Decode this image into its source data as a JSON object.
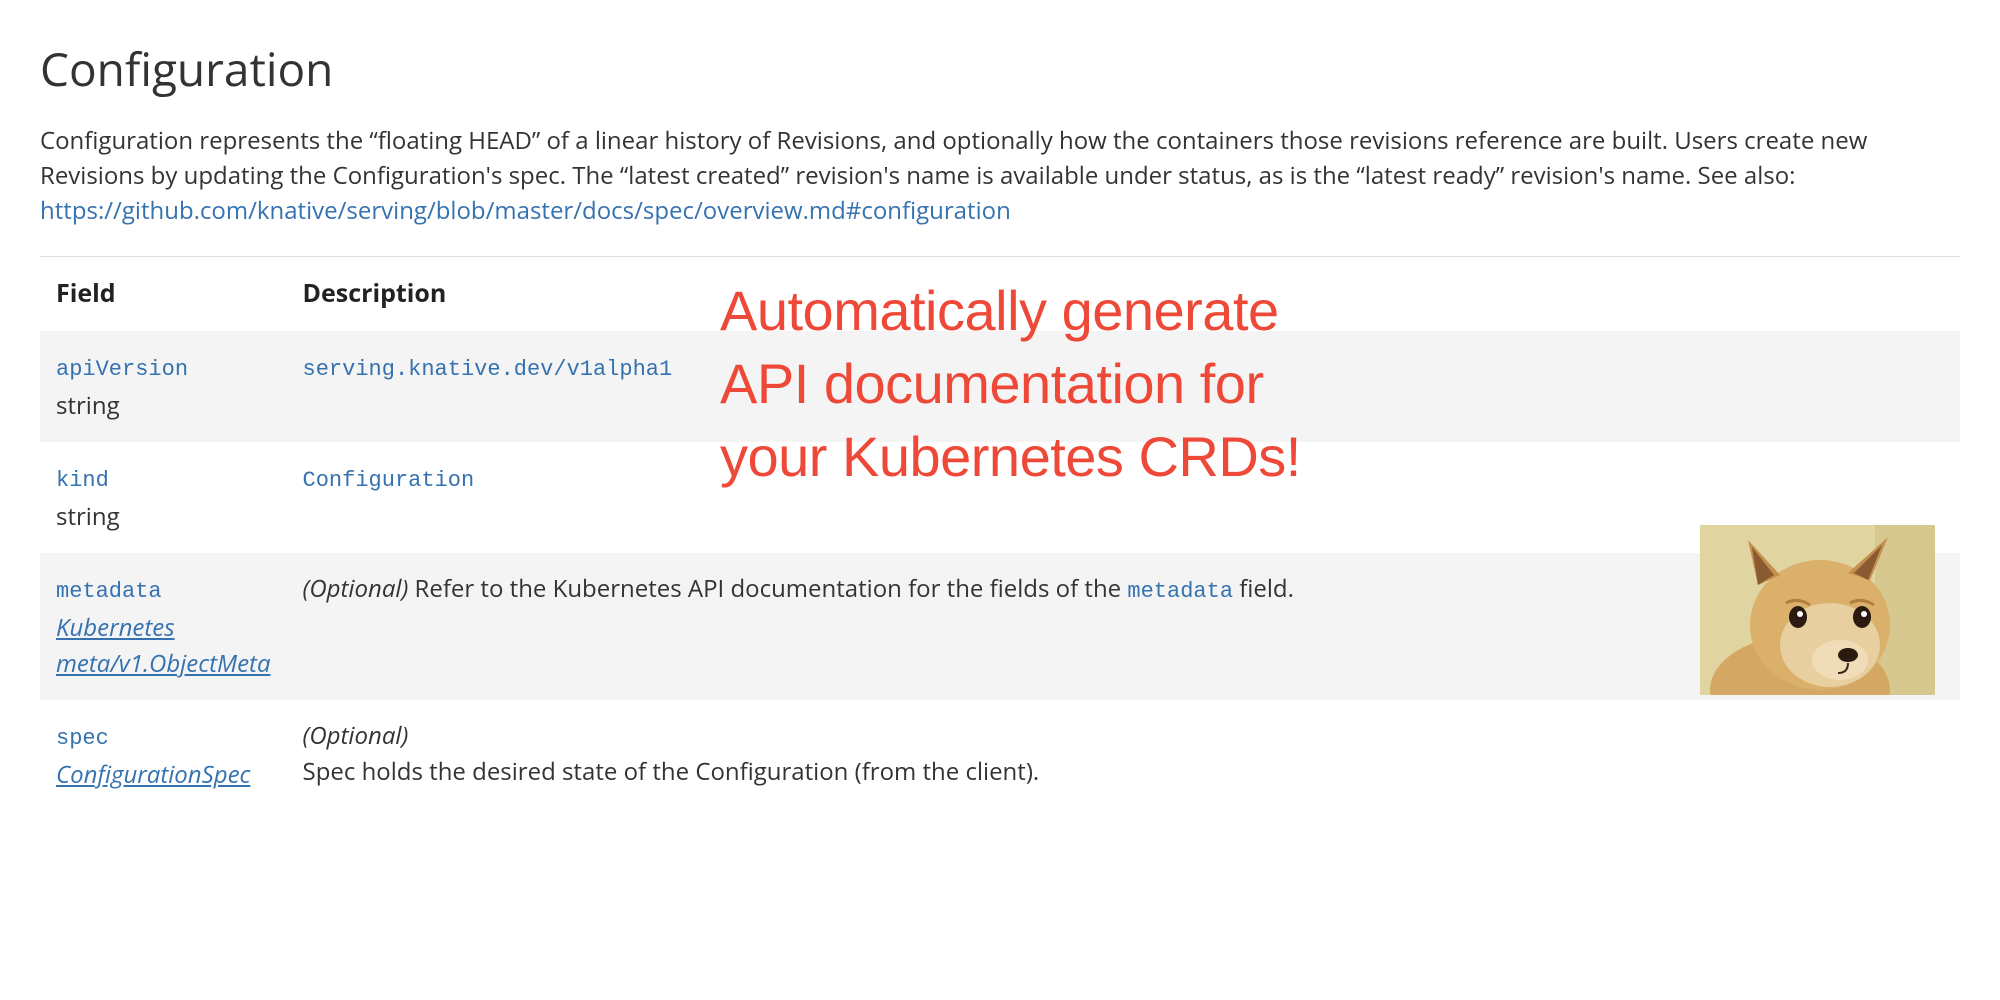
{
  "title": "Configuration",
  "intro": {
    "text": "Configuration represents the “floating HEAD” of a linear history of Revisions, and optionally how the containers those revisions reference are built. Users create new Revisions by updating the Configuration's spec. The “latest created” revision's name is available under status, as is the “latest ready” revision's name. See also:",
    "link": "https://github.com/knative/serving/blob/master/docs/spec/overview.md#configuration"
  },
  "table": {
    "headers": {
      "field": "Field",
      "description": "Description"
    },
    "rows": {
      "apiVersion": {
        "name": "apiVersion",
        "type": "string",
        "value": "serving.knative.dev/v1alpha1"
      },
      "kind": {
        "name": "kind",
        "type": "string",
        "value": "Configuration"
      },
      "metadata": {
        "name": "metadata",
        "typeLink": "Kubernetes meta/v1.ObjectMeta",
        "optional": "(Optional)",
        "descPrefix": " Refer to the Kubernetes API documentation for the fields of the ",
        "descCode": "metadata",
        "descSuffix": " field."
      },
      "spec": {
        "name": "spec",
        "typeLink": "ConfigurationSpec",
        "optional": "(Optional)",
        "desc": "Spec holds the desired state of the Configuration (from the client)."
      }
    }
  },
  "overlay": {
    "line1": "Automatically generate",
    "line2": "API documentation for",
    "line3": "your Kubernetes CRDs!"
  },
  "doge_alt": "doge-meme-image"
}
